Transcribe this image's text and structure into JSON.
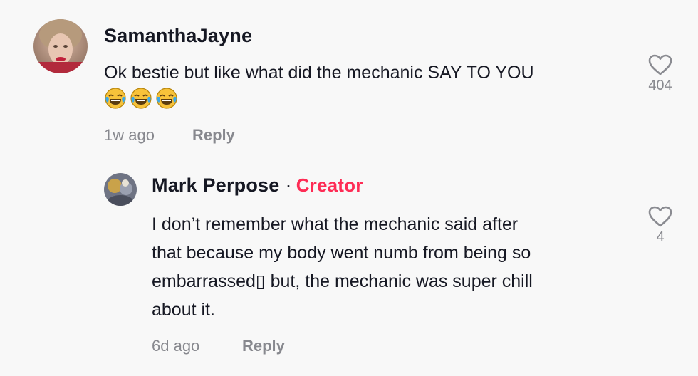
{
  "comments": [
    {
      "username": "SamanthaJayne",
      "text": "Ok bestie but like what did the mechanic SAY TO YOU",
      "emojis": [
        "tears-of-joy",
        "tears-of-joy",
        "tears-of-joy"
      ],
      "time": "1w ago",
      "reply_label": "Reply",
      "likes": "404"
    },
    {
      "username": "Mark Perpose",
      "separator": "·",
      "badge": "Creator",
      "text_lines": [
        "I don’t remember what the mechanic said after",
        "that because my body went numb from being so",
        "embarrassed▯ but, the mechanic was super chill",
        "about it."
      ],
      "time": "6d ago",
      "reply_label": "Reply",
      "likes": "4"
    }
  ],
  "colors": {
    "background": "#f8f8f8",
    "text": "#161823",
    "muted": "#8a8b91",
    "creator_badge": "#fe2c55"
  },
  "icons": {
    "like": "heart-outline-icon",
    "emoji": "face-with-tears-of-joy"
  }
}
